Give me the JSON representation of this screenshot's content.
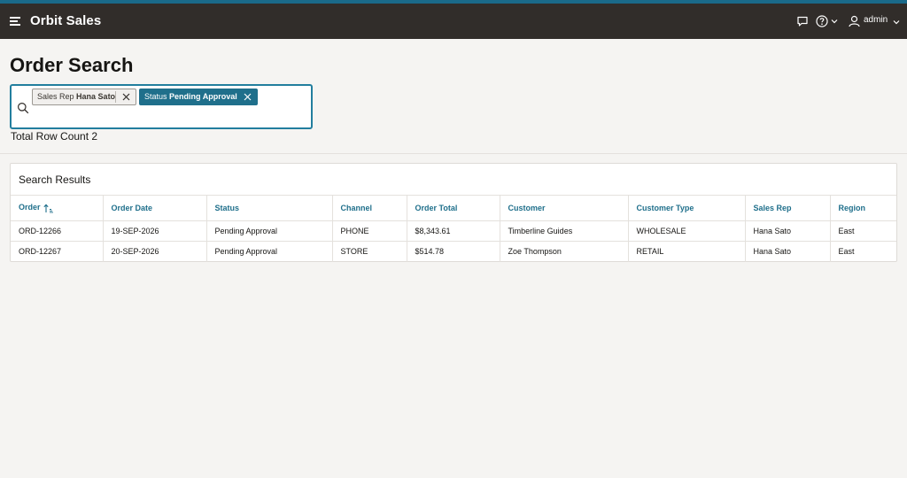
{
  "header": {
    "app_title": "Orbit Sales",
    "user_name": "admin",
    "icons": [
      "menu-icon",
      "chat-icon",
      "help-icon",
      "user-icon",
      "chevron-down-icon"
    ]
  },
  "page": {
    "title": "Order Search",
    "row_count": "Total Row Count 2"
  },
  "search": {
    "filters": [
      {
        "label": "Sales Rep",
        "value": "Hana Sato"
      },
      {
        "label": "Status",
        "value": "Pending Approval"
      }
    ]
  },
  "results": {
    "title": "Search Results",
    "columns": [
      "Order",
      "Order Date",
      "Status",
      "Channel",
      "Order Total",
      "Customer",
      "Customer Type",
      "Sales Rep",
      "Region"
    ],
    "rows": [
      [
        "ORD-12266",
        "19-SEP-2026",
        "Pending Approval",
        "PHONE",
        "$8,343.61",
        "Timberline Guides",
        "WHOLESALE",
        "Hana Sato",
        "East"
      ],
      [
        "ORD-12267",
        "20-SEP-2026",
        "Pending Approval",
        "STORE",
        "$514.78",
        "Zoe Thompson",
        "RETAIL",
        "Hana Sato",
        "East"
      ]
    ]
  },
  "colors": {
    "header_bg": "#312d2a",
    "accent": "#1f6f8b",
    "top_stripe": "#1a6a8a"
  }
}
